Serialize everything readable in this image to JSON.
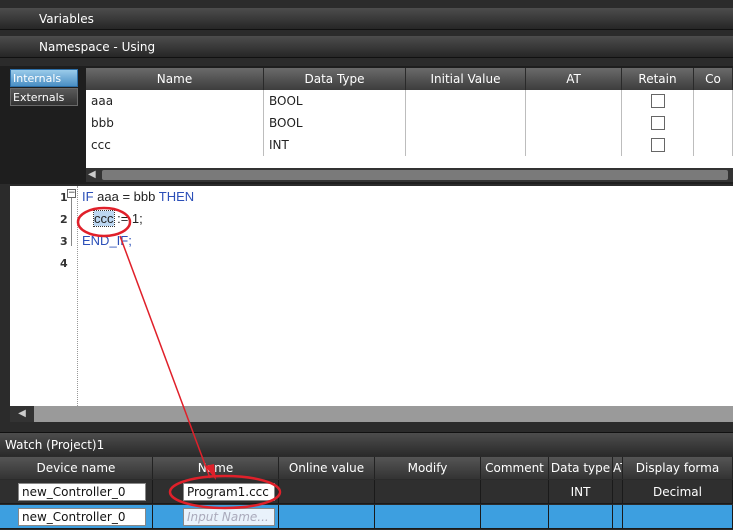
{
  "panels": {
    "variables_title": "Variables",
    "namespace_title": "Namespace - Using"
  },
  "var_tabs": [
    "Internals",
    "Externals"
  ],
  "var_table": {
    "headers": [
      "Name",
      "Data Type",
      "Initial Value",
      "AT",
      "Retain",
      "Co"
    ],
    "rows": [
      {
        "name": "aaa",
        "type": "BOOL"
      },
      {
        "name": "bbb",
        "type": "BOOL"
      },
      {
        "name": "ccc",
        "type": "INT"
      }
    ]
  },
  "editor": {
    "line_numbers": [
      "1",
      "2",
      "3",
      "4"
    ],
    "kw_if": "IF",
    "line1_mid": " aaa = bbb ",
    "kw_then": "THEN",
    "line2_var": "ccc",
    "line2_rest": " := 1;",
    "kw_endif": "END_IF;"
  },
  "watch": {
    "title": "Watch (Project)1",
    "headers": [
      "Device name",
      "Name",
      "Online value",
      "Modify",
      "Comment",
      "Data type",
      "AT",
      "Display forma"
    ],
    "rows": [
      {
        "device": "new_Controller_0",
        "name": "Program1.ccc",
        "type": "INT",
        "display": "Decimal"
      },
      {
        "device": "new_Controller_0",
        "placeholder": "Input Name..."
      }
    ]
  },
  "colors": {
    "annotation": "#e0202a",
    "selection": "#3d9fe0"
  }
}
